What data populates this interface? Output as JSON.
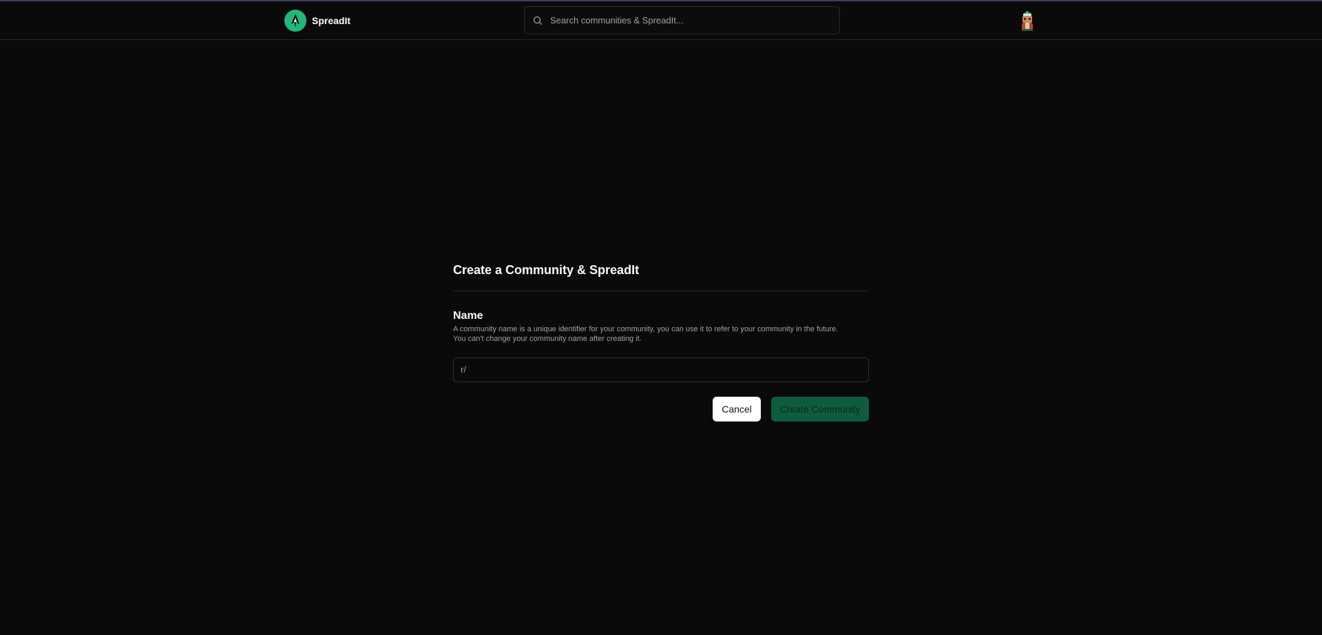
{
  "header": {
    "brand_name": "SpreadIt",
    "search_placeholder": "Search communities & SpreadIt..."
  },
  "form": {
    "title": "Create a Community & SpreadIt",
    "name_label": "Name",
    "help_line1": "A community name is a unique identifier for your community, you can use it to refer to your community in the future.",
    "help_line2": "You can't change your community name after creating it.",
    "prefix": "r/",
    "name_value": "",
    "cancel_label": "Cancel",
    "create_label": "Create Community"
  },
  "icons": {
    "logo": "spreadit-logo-icon",
    "search": "search-icon",
    "avatar": "user-avatar"
  },
  "colors": {
    "background": "#0a0a0a",
    "brand_green": "#1fb87a",
    "create_button": "#0d5c3e",
    "cancel_button": "#ffffff"
  }
}
